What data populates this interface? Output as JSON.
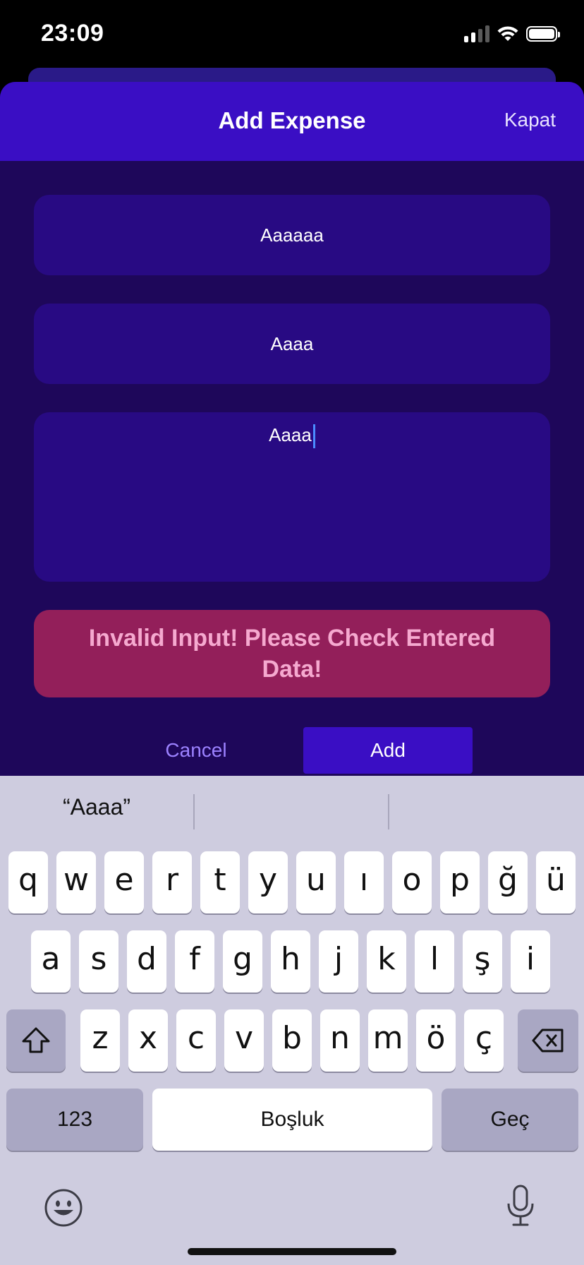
{
  "status_bar": {
    "time": "23:09"
  },
  "sheet": {
    "title": "Add Expense",
    "close_label": "Kapat",
    "fields": [
      "Aaaaaa",
      "Aaaa",
      "Aaaa"
    ],
    "error_message": "Invalid Input! Please Check Entered Data!",
    "cancel_label": "Cancel",
    "add_label": "Add"
  },
  "keyboard": {
    "suggestions": [
      "“Aaaa”",
      "",
      ""
    ],
    "row1": [
      "q",
      "w",
      "e",
      "r",
      "t",
      "y",
      "u",
      "ı",
      "o",
      "p",
      "ğ",
      "ü"
    ],
    "row2": [
      "a",
      "s",
      "d",
      "f",
      "g",
      "h",
      "j",
      "k",
      "l",
      "ş",
      "i"
    ],
    "row3": [
      "z",
      "x",
      "c",
      "v",
      "b",
      "n",
      "m",
      "ö",
      "ç"
    ],
    "numbers_label": "123",
    "space_label": "Boşluk",
    "return_label": "Geç",
    "icons": [
      "shift-icon",
      "backspace-icon",
      "emoji-icon",
      "microphone-icon"
    ]
  },
  "colors": {
    "sheet_background": "#1e075a",
    "header_background": "#3a0ec4",
    "field_background": "#280a83",
    "error_background": "#931f5a",
    "error_text": "#f5a9cf",
    "cancel_text": "#9c82ff",
    "keyboard_background": "#ceccdf"
  }
}
